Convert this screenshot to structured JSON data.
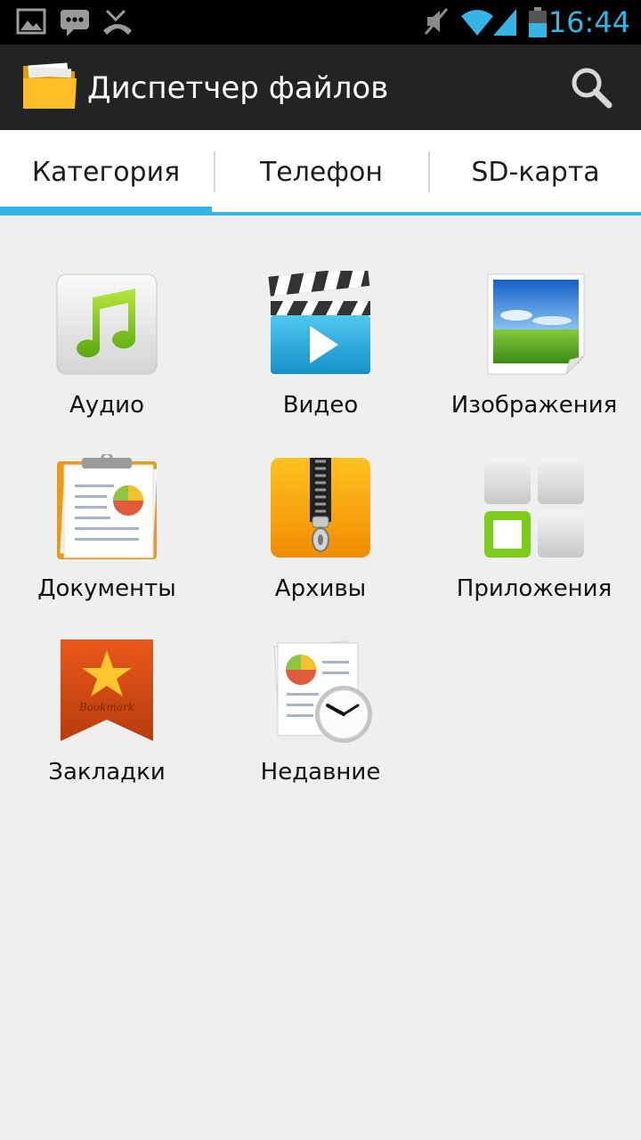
{
  "status_bar": {
    "time": "16:44",
    "time_color": "#33b5e5",
    "icons": [
      "gallery-icon",
      "message-icon",
      "missed-call-icon",
      "mute-icon",
      "wifi-icon",
      "signal-icon",
      "battery-icon"
    ]
  },
  "action_bar": {
    "title": "Диспетчер файлов",
    "app_icon": "folder-icon",
    "search_icon": "search-icon"
  },
  "tabs": [
    {
      "label": "Категория",
      "selected": true
    },
    {
      "label": "Телефон",
      "selected": false
    },
    {
      "label": "SD-карта",
      "selected": false
    }
  ],
  "accent_color": "#33b5e5",
  "categories": [
    {
      "label": "Аудио",
      "icon": "audio-icon"
    },
    {
      "label": "Видео",
      "icon": "video-icon"
    },
    {
      "label": "Изображения",
      "icon": "images-icon"
    },
    {
      "label": "Документы",
      "icon": "documents-icon"
    },
    {
      "label": "Архивы",
      "icon": "archives-icon"
    },
    {
      "label": "Приложения",
      "icon": "apps-icon"
    },
    {
      "label": "Закладки",
      "icon": "bookmarks-icon",
      "icon_text": "Bookmark"
    },
    {
      "label": "Недавние",
      "icon": "recent-icon"
    }
  ]
}
